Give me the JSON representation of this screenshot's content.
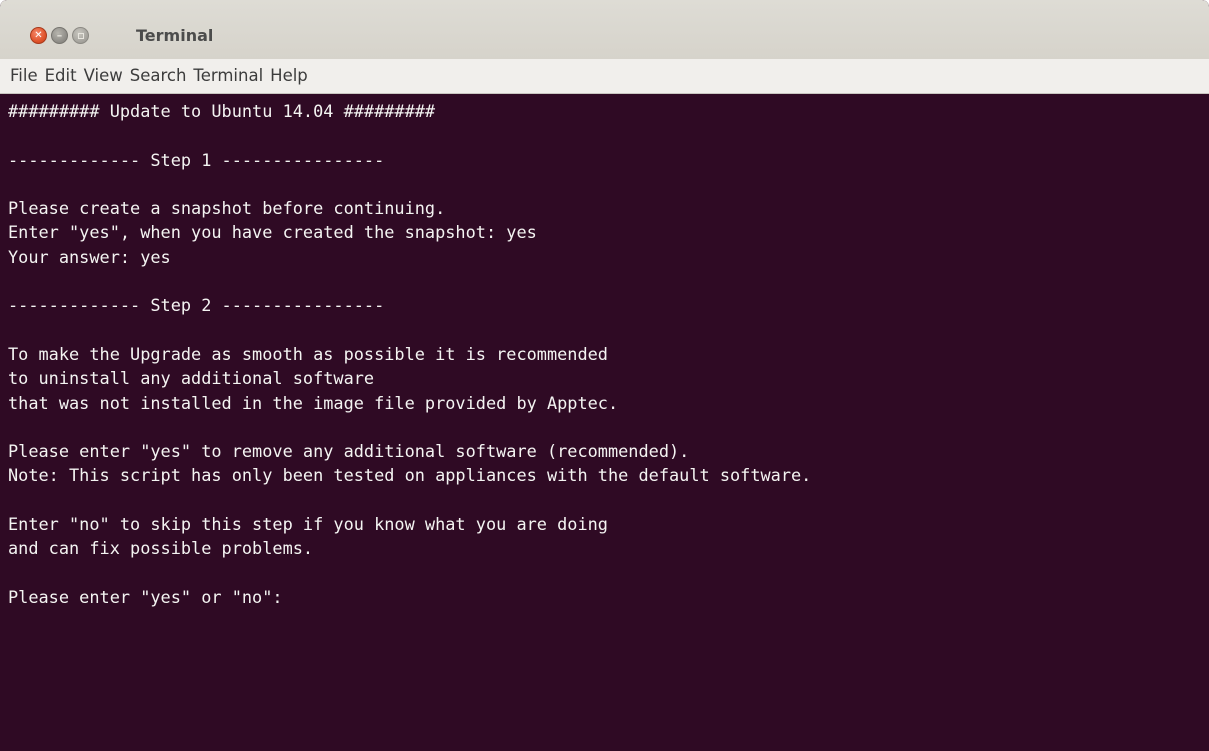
{
  "window": {
    "title": "Terminal"
  },
  "menubar": {
    "items": [
      "File",
      "Edit",
      "View",
      "Search",
      "Terminal",
      "Help"
    ]
  },
  "terminal": {
    "lines": [
      "######### Update to Ubuntu 14.04 #########",
      "",
      "------------- Step 1 ----------------",
      "",
      "Please create a snapshot before continuing.",
      "Enter \"yes\", when you have created the snapshot: yes",
      "Your answer: yes",
      "",
      "------------- Step 2 ----------------",
      "",
      "To make the Upgrade as smooth as possible it is recommended",
      "to uninstall any additional software",
      "that was not installed in the image file provided by Apptec.",
      "",
      "Please enter \"yes\" to remove any additional software (recommended).",
      "Note: This script has only been tested on appliances with the default software.",
      "",
      "Enter \"no\" to skip this step if you know what you are doing",
      "and can fix possible problems.",
      "",
      "Please enter \"yes\" or \"no\":"
    ]
  },
  "colors": {
    "terminal_background": "#2f0a24",
    "terminal_text": "#f4f4f2",
    "titlebar": "#d9d7d0",
    "menubar": "#f1efec",
    "close_button": "#e0542c"
  },
  "icons": {
    "close": "close-icon",
    "minimize": "minimize-icon",
    "maximize": "maximize-icon"
  }
}
